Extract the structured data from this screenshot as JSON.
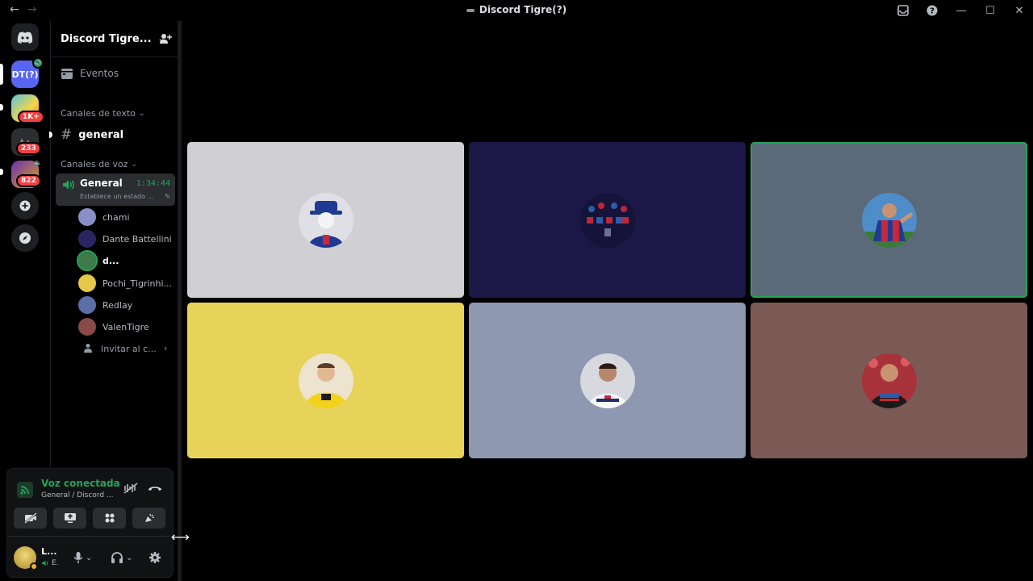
{
  "window": {
    "title": "Discord Tigre(?)"
  },
  "server_rail": {
    "servers": [
      {
        "name": "home",
        "label": ""
      },
      {
        "name": "discord-tigre",
        "label": "DT(?)"
      },
      {
        "name": "server-2",
        "badge": "1K+"
      },
      {
        "name": "server-3",
        "badge": "233"
      },
      {
        "name": "server-4",
        "badge": "822"
      }
    ]
  },
  "sidebar": {
    "server_name": "Discord Tigre...",
    "events_label": "Eventos",
    "text_category": "Canales de texto",
    "text_channel": "general",
    "voice_category": "Canales de voz",
    "voice_channel": {
      "name": "General",
      "timer": "1:34:44",
      "status": "Establece un estado ..."
    },
    "members": [
      {
        "name": "chami",
        "color": "#8b8fc7"
      },
      {
        "name": "Dante Battellini",
        "color": "#1e1b4b"
      },
      {
        "name": "d...",
        "color": "#3d7a4a"
      },
      {
        "name": "Pochi_Tigrinhi...",
        "color": "#e5c84a"
      },
      {
        "name": "Redlay",
        "color": "#5b6ea8"
      },
      {
        "name": "ValenTigre",
        "color": "#8a4a4a"
      }
    ],
    "invite_label": "Invitar al c..."
  },
  "voice_panel": {
    "title": "Voz conectada",
    "subtitle": "General / Discord ..."
  },
  "user_panel": {
    "name": "L...",
    "status": "E."
  },
  "tiles": [
    {
      "name": "tile-1",
      "bg": "#cfcfd4",
      "avatar_bg": "#e8e8ec",
      "figure": "#1f3a93"
    },
    {
      "name": "tile-2",
      "bg": "#1b1847",
      "avatar_bg": "#131238",
      "figure": "#b8283a"
    },
    {
      "name": "tile-3",
      "bg": "#5b6a78",
      "avatar_bg": "#3a7fc1",
      "figure": "#c43a2c",
      "speaking": true
    },
    {
      "name": "tile-4",
      "bg": "#e7d35a",
      "avatar_bg": "#f0e6c8",
      "figure": "#f2d21b"
    },
    {
      "name": "tile-5",
      "bg": "#8f98b1",
      "avatar_bg": "#dcdde2",
      "figure": "#1b2c6e"
    },
    {
      "name": "tile-6",
      "bg": "#7b5a56",
      "avatar_bg": "#b2323a",
      "figure": "#1a1a1a"
    }
  ],
  "colors": {
    "accent": "#5865f2",
    "green": "#23a55a",
    "badge_red": "#f23f43"
  }
}
